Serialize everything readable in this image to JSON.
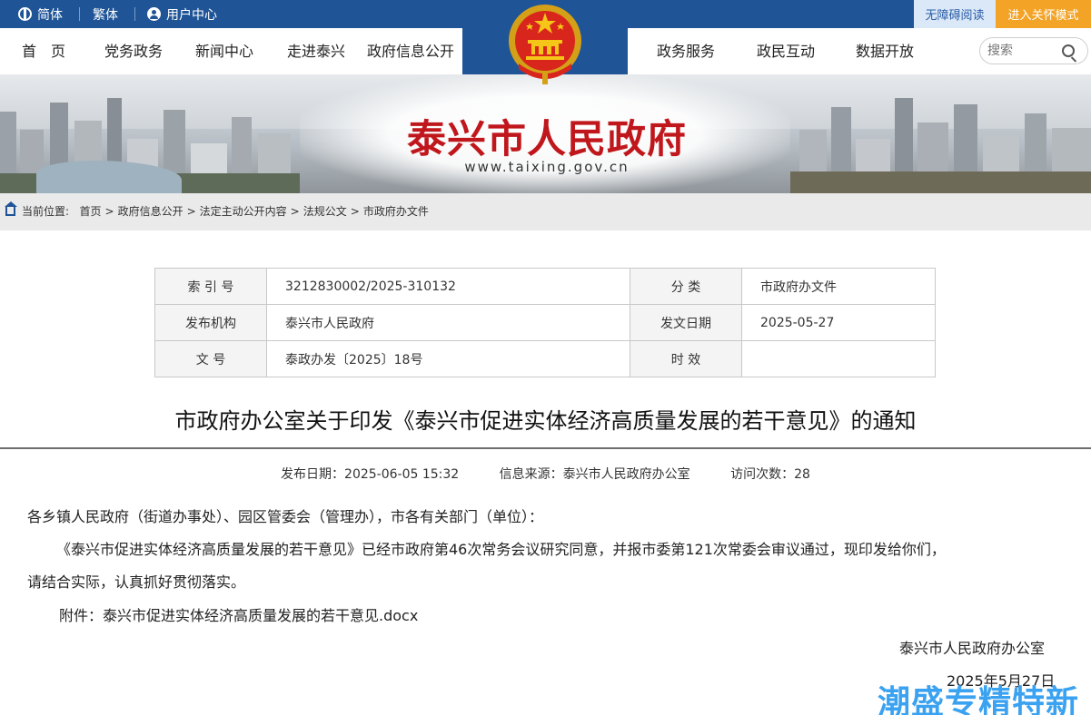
{
  "topbar": {
    "simplified": "简体",
    "traditional": "繁体",
    "user_center": "用户中心",
    "accessibility": "无障碍阅读",
    "elder_mode": "进入关怀模式"
  },
  "nav": {
    "items": [
      "首　页",
      "党务政务",
      "新闻中心",
      "走进泰兴",
      "政府信息公开",
      "政务服务",
      "政民互动",
      "数据开放"
    ],
    "search_placeholder": "搜索"
  },
  "banner": {
    "title": "泰兴市人民政府",
    "url": "www.taixing.gov.cn"
  },
  "breadcrumb": {
    "label": "当前位置:",
    "items": [
      "首页",
      "政府信息公开",
      "法定主动公开内容",
      "法规公文",
      "市政府办文件"
    ]
  },
  "info_table": {
    "index_label": "索 引 号",
    "index_value": "3212830002/2025-310132",
    "category_label": "分 类",
    "category_value": "市政府办文件",
    "publisher_label": "发布机构",
    "publisher_value": "泰兴市人民政府",
    "issue_date_label": "发文日期",
    "issue_date_value": "2025-05-27",
    "doc_no_label": "文 号",
    "doc_no_value": "泰政办发〔2025〕18号",
    "validity_label": "时 效",
    "validity_value": ""
  },
  "article": {
    "title": "市政府办公室关于印发《泰兴市促进实体经济高质量发展的若干意见》的通知",
    "publish_date": "发布日期：2025-06-05 15:32",
    "source": "信息来源：泰兴市人民政府办公室",
    "visits": "访问次数：28",
    "salutation": "各乡镇人民政府（街道办事处）、园区管委会（管理办），市各有关部门（单位）：",
    "para1_line1": "《泰兴市促进实体经济高质量发展的若干意见》已经市政府第46次常务会议研究同意，并报市委第121次常委会审议通过，现印发给你们，",
    "para1_line2": "请结合实际，认真抓好贯彻落实。",
    "attachment_label": "附件：",
    "attachment_file": "泰兴市促进实体经济高质量发展的若干意见.docx",
    "signer": "泰兴市人民政府办公室",
    "sign_date": "2025年5月27日"
  },
  "watermark": "潮盛专精特新",
  "colors": {
    "topbar": "#1f5497",
    "elder": "#f3a325",
    "title_red": "#c0171c",
    "watermark": "#3aa2f0"
  }
}
